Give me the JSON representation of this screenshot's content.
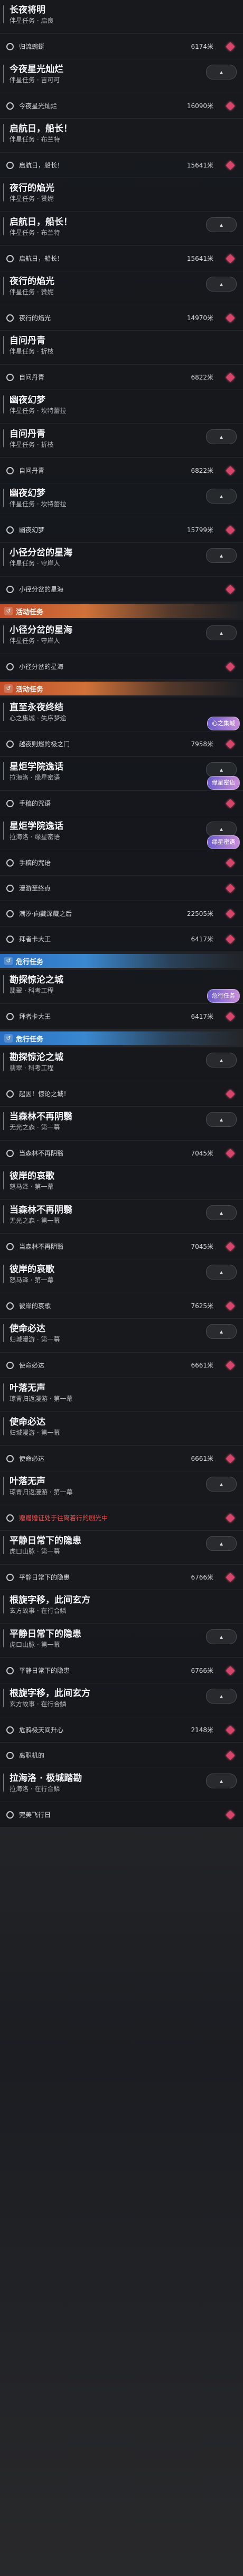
{
  "collapse_label": "▴",
  "items": [
    {
      "kind": "head",
      "title": "长夜将明",
      "sub": "伴星任务 · 启良"
    },
    {
      "kind": "step",
      "text": "归流蜿蜒",
      "dist": "6174米"
    },
    {
      "kind": "head",
      "title": "今夜星光灿烂",
      "sub": "伴星任务 · 吉可可",
      "collapse": true
    },
    {
      "kind": "step",
      "text": "今夜星光灿烂",
      "dist": "16090米"
    },
    {
      "kind": "head",
      "title": "启航日，船长！",
      "sub": "伴星任务 · 布兰特"
    },
    {
      "kind": "step",
      "text": "启航日，船长！",
      "dist": "15641米"
    },
    {
      "kind": "head",
      "title": "夜行的焰光",
      "sub": "伴星任务 · 赞妮"
    },
    {
      "kind": "head",
      "title": "启航日，船长！",
      "sub": "伴星任务 · 布兰特",
      "collapse": true
    },
    {
      "kind": "step",
      "text": "启航日，船长！",
      "dist": "15641米"
    },
    {
      "kind": "head",
      "title": "夜行的焰光",
      "sub": "伴星任务 · 赞妮",
      "collapse": true
    },
    {
      "kind": "step",
      "text": "夜行的焰光",
      "dist": "14970米"
    },
    {
      "kind": "head",
      "title": "自问丹青",
      "sub": "伴星任务 · 折枝"
    },
    {
      "kind": "step",
      "text": "自问丹青",
      "dist": "6822米"
    },
    {
      "kind": "head",
      "title": "幽夜幻梦",
      "sub": "伴星任务 · 坎特蕾拉"
    },
    {
      "kind": "head",
      "title": "自问丹青",
      "sub": "伴星任务 · 折枝",
      "collapse": true
    },
    {
      "kind": "step",
      "text": "自问丹青",
      "dist": "6822米"
    },
    {
      "kind": "head",
      "title": "幽夜幻梦",
      "sub": "伴星任务 · 坎特蕾拉",
      "collapse": true
    },
    {
      "kind": "step",
      "text": "幽夜幻梦",
      "dist": "15799米"
    },
    {
      "kind": "head",
      "title": "小径分岔的星海",
      "sub": "伴星任务 · 守岸人",
      "collapse": true
    },
    {
      "kind": "step",
      "text": "小径分岔的星海",
      "dist": ""
    },
    {
      "kind": "sec",
      "text": "活动任务",
      "color": "orange"
    },
    {
      "kind": "head",
      "title": "小径分岔的星海",
      "sub": "伴星任务 · 守岸人",
      "collapse": true
    },
    {
      "kind": "step",
      "text": "小径分岔的星海",
      "dist": ""
    },
    {
      "kind": "sec",
      "text": "活动任务",
      "color": "orange"
    },
    {
      "kind": "head",
      "title": "直至永夜终结",
      "sub": "心之集城 · 失序梦途",
      "badge": "心之集城"
    },
    {
      "kind": "step",
      "text": "越夜则燃的极之门",
      "dist": "7958米"
    },
    {
      "kind": "head",
      "title": "星炬学院逸话",
      "sub": "拉海洛 · 缘星密语",
      "collapse": true,
      "badge": "缘星密语"
    },
    {
      "kind": "step",
      "text": "手稿的咒语",
      "dist": ""
    },
    {
      "kind": "head",
      "title": "星炬学院逸话",
      "sub": "拉海洛 · 缘星密语",
      "collapse": true,
      "badge": "缘星密语"
    },
    {
      "kind": "step",
      "text": "手稿的咒语",
      "dist": ""
    },
    {
      "kind": "step",
      "text": "漫游至终点",
      "dist": ""
    },
    {
      "kind": "step",
      "text": "潮汐·向藏深藏之后",
      "dist": "22505米"
    },
    {
      "kind": "step",
      "text": "拜者卡大王",
      "dist": "6417米"
    },
    {
      "kind": "sec",
      "text": "危行任务",
      "color": "blue"
    },
    {
      "kind": "head",
      "title": "勘探惊沦之城",
      "sub": "翡翠 · 科考工程",
      "badge": "危行任务"
    },
    {
      "kind": "step",
      "text": "拜者卡大王",
      "dist": "6417米"
    },
    {
      "kind": "sec",
      "text": "危行任务",
      "color": "blue"
    },
    {
      "kind": "head",
      "title": "勘探惊沦之城",
      "sub": "翡翠 · 科考工程",
      "collapse": true
    },
    {
      "kind": "step",
      "text": "起因！惊论之城！",
      "dist": ""
    },
    {
      "kind": "head",
      "title": "当森林不再阴翳",
      "sub": "无光之森 · 第一幕",
      "collapse": true
    },
    {
      "kind": "step",
      "text": "当森林不再阴翳",
      "dist": "7045米"
    },
    {
      "kind": "head",
      "title": "彼岸的哀歌",
      "sub": "怒马泽 · 第一幕"
    },
    {
      "kind": "head",
      "title": "当森林不再阴翳",
      "sub": "无光之森 · 第一幕",
      "collapse": true
    },
    {
      "kind": "step",
      "text": "当森林不再阴翳",
      "dist": "7045米"
    },
    {
      "kind": "head",
      "title": "彼岸的哀歌",
      "sub": "怒马泽 · 第一幕",
      "collapse": true
    },
    {
      "kind": "step",
      "text": "彼岸的哀歌",
      "dist": "7625米"
    },
    {
      "kind": "head",
      "title": "使命必达",
      "sub": "归城漫游 · 第一幕",
      "collapse": true
    },
    {
      "kind": "step",
      "text": "使命必达",
      "dist": "6661米"
    },
    {
      "kind": "head",
      "title": "叶落无声",
      "sub": "琼青归返漫游 · 第一幕"
    },
    {
      "kind": "head",
      "title": "使命必达",
      "sub": "归城漫游 · 第一幕"
    },
    {
      "kind": "step",
      "text": "使命必达",
      "dist": "6661米"
    },
    {
      "kind": "head",
      "title": "叶落无声",
      "sub": "琼青归返漫游 · 第一幕",
      "collapse": true
    },
    {
      "kind": "step",
      "text": "叶落无声",
      "dist": "",
      "red": "赠赠赠证处于往离着行的剧光中"
    },
    {
      "kind": "head",
      "title": "平静日常下的隐患",
      "sub": "虎口山脉 · 第一幕",
      "collapse": true
    },
    {
      "kind": "step",
      "text": "平静日常下的隐患",
      "dist": "6766米"
    },
    {
      "kind": "head",
      "title": "根旋字移，此间玄方",
      "sub": "玄方故事 · 在行合鳞"
    },
    {
      "kind": "head",
      "title": "平静日常下的隐患",
      "sub": "虎口山脉 · 第一幕",
      "collapse": true
    },
    {
      "kind": "step",
      "text": "平静日常下的隐患",
      "dist": "6766米"
    },
    {
      "kind": "head",
      "title": "根旋字移，此间玄方",
      "sub": "玄方故事 · 在行合鳞",
      "collapse": true
    },
    {
      "kind": "step",
      "text": "危鸦极天间升心",
      "dist": "2148米"
    },
    {
      "kind": "step",
      "text": "离职机的",
      "dist": ""
    },
    {
      "kind": "head",
      "title": "拉海洛 · 极城踏勘",
      "sub": "拉海洛 · 在行合鳞",
      "collapse": true
    },
    {
      "kind": "step",
      "text": "完美飞行日",
      "dist": ""
    }
  ]
}
